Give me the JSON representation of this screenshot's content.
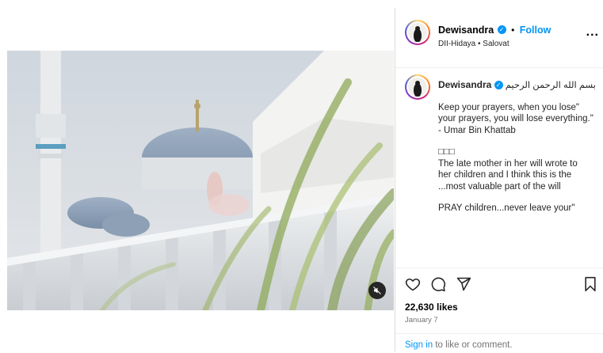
{
  "post": {
    "username": "Dewisandra",
    "follow_label": "Follow",
    "separator": "•",
    "location": "DII-Hidaya • Salovat",
    "more_label": "...",
    "caption_lines": [
      "بسم الله الرحمن الرحيم",
      "",
      "Keep your prayers, when you lose\"",
      "your prayers, you will lose everything.\"",
      "- Umar Bin Khattab",
      "",
      "□□□",
      "The late mother in her will wrote to",
      "her children and I think this is the",
      "...most valuable part of the will",
      "",
      "PRAY children...never leave your\""
    ],
    "likes": "22,630 likes",
    "date": "January 7",
    "signin_link": "Sign in",
    "signin_rest": " to like or comment."
  },
  "icons": {
    "like": "heart-icon",
    "comment": "comment-icon",
    "share": "share-icon",
    "save": "bookmark-icon",
    "mute": "speaker-muted-icon",
    "verified": "verified-badge-icon"
  },
  "colors": {
    "accent": "#0095f6",
    "verified": "#0095f6",
    "muted_text": "#737373"
  }
}
